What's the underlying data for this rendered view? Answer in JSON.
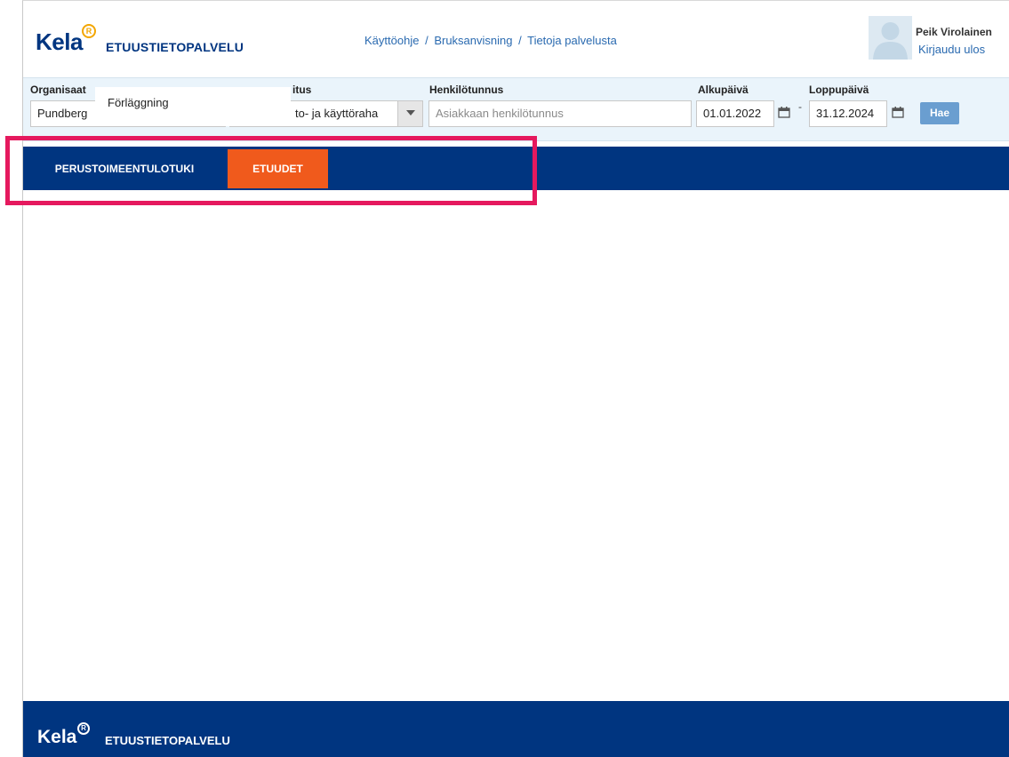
{
  "header": {
    "logo": "Kela",
    "logo_mark": "R",
    "service_name": "ETUUSTIETOPALVELU",
    "links": [
      "Käyttöohje",
      "Bruksanvisning",
      "Tietoja palvelusta"
    ],
    "separator": "/",
    "user_name": "Peik Virolainen",
    "logout_label": "Kirjaudu ulos",
    "avatar_icon": "user-avatar-icon"
  },
  "search": {
    "org_label": "Organisaat",
    "org_value": "Pundberg",
    "purpose_label": "itus",
    "purpose_value": "to- ja käyttöraha",
    "ssn_label": "Henkilötunnus",
    "ssn_placeholder": "Asiakkaan henkilötunnus",
    "start_label": "Alkupäivä",
    "start_value": "01.01.2022",
    "end_label": "Loppupäivä",
    "end_value": "31.12.2024",
    "range_separator": "-",
    "search_button": "Hae",
    "popup_text": "Förläggning",
    "calendar_icon": "calendar-icon",
    "dropdown_icon": "caret-down-icon"
  },
  "nav": {
    "tabs": [
      {
        "label": "PERUSTOIMEENTULOTUKI",
        "active": false
      },
      {
        "label": "ETUUDET",
        "active": true
      }
    ],
    "active_color": "#f05a1c",
    "bar_color": "#003580"
  },
  "footer": {
    "logo": "Kela",
    "logo_mark": "R",
    "service_name": "ETUUSTIETOPALVELU"
  },
  "colors": {
    "brand": "#003580",
    "highlight": "#e5195e",
    "link": "#2a6ab0"
  }
}
